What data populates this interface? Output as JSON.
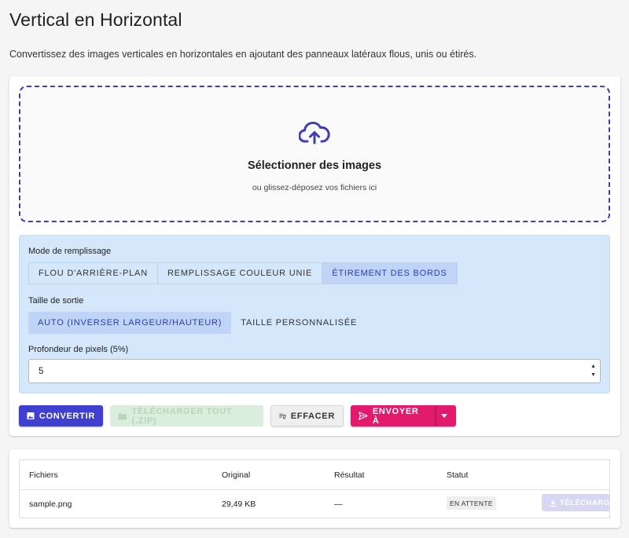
{
  "page": {
    "title": "Vertical en Horizontal",
    "subtitle": "Convertissez des images verticales en horizontales en ajoutant des panneaux latéraux flous, unis ou étirés."
  },
  "dropzone": {
    "icon": "cloud-upload-icon",
    "title": "Sélectionner des images",
    "subtitle": "ou glissez-déposez vos fichiers ici"
  },
  "options": {
    "fill_mode": {
      "label": "Mode de remplissage",
      "buttons": [
        "Flou d'arrière-plan",
        "Remplissage couleur unie",
        "Étirement des bords"
      ],
      "selected": "Étirement des bords"
    },
    "output_size": {
      "label": "Taille de sortie",
      "buttons": [
        "Auto (inverser largeur/hauteur)",
        "Taille personnalisée"
      ],
      "selected": "Auto (inverser largeur/hauteur)"
    },
    "pixel_depth": {
      "label": "Profondeur de pixels (5%)",
      "value": "5"
    }
  },
  "actions": {
    "convert": "Convertir",
    "download_all": "Télécharger tout (.zip)",
    "clear": "Effacer",
    "send_to": "Envoyer à"
  },
  "table": {
    "headers": [
      "Fichiers",
      "Original",
      "Résultat",
      "Statut"
    ],
    "rows": [
      {
        "file": "sample.png",
        "original": "29,49 KB",
        "result": "—",
        "status": "EN ATTENTE",
        "action": "TÉLÉCHARGER"
      }
    ]
  },
  "colors": {
    "accent": "#3f3fd0",
    "send": "#e21a6c",
    "options_bg": "#d4e7fb",
    "dropzone_border": "#3f3fb3"
  }
}
